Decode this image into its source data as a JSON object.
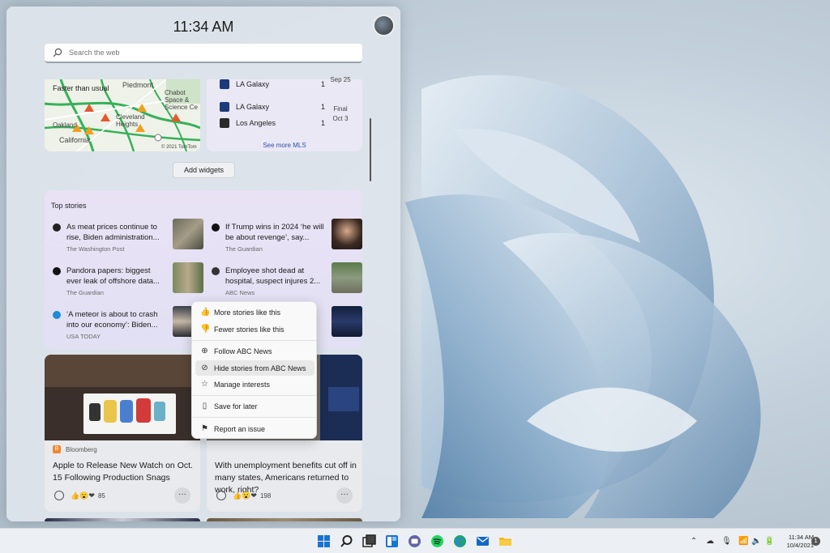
{
  "panel": {
    "time": "11:34 AM",
    "search_placeholder": "Search the web",
    "add_widgets": "Add widgets"
  },
  "map": {
    "status": "Faster than usual",
    "places": [
      "Piedmont",
      "Chabot Space & Science Ce",
      "Cleveland Heights",
      "Oakland",
      "California"
    ],
    "copyright": "© 2021 TomTom"
  },
  "sports": {
    "rows": [
      {
        "team": "LA Galaxy",
        "score": "1"
      },
      {
        "team": "LA Galaxy",
        "score": "1"
      },
      {
        "team": "Los Angeles",
        "score": "1"
      }
    ],
    "status_top": "Sep 25",
    "status_final": "Final",
    "status_date": "Oct 3",
    "see_more": "See more MLS"
  },
  "top_stories": {
    "header": "Top stories",
    "items": [
      {
        "title": "As meat prices continue to rise, Biden administration...",
        "publisher": "The Washington Post"
      },
      {
        "title": "If Trump wins in 2024 ‘he will be about revenge’, say...",
        "publisher": "The Guardian"
      },
      {
        "title": "Pandora papers: biggest ever leak of offshore data...",
        "publisher": "The Guardian"
      },
      {
        "title": "Employee shot dead at hospital, suspect injures 2...",
        "publisher": "ABC News"
      },
      {
        "title": "‘A meteor is about to crash into our economy’: Biden...",
        "publisher": "USA TODAY"
      }
    ]
  },
  "cards": [
    {
      "publisher": "Bloomberg",
      "title": "Apple to Release New Watch on Oct. 15 Following Production Snags",
      "reactions": "85"
    },
    {
      "publisher": "",
      "title": "With unemployment benefits cut off in many states, Americans returned to work, right?",
      "reactions": "198"
    }
  ],
  "context_menu": {
    "items": [
      "More stories like this",
      "Fewer stories like this",
      "Follow ABC News",
      "Hide stories from ABC News",
      "Manage interests",
      "Save for later",
      "Report an issue"
    ]
  },
  "taskbar": {
    "time": "11:34 AM",
    "date": "10/4/2021",
    "notifications": "1"
  }
}
